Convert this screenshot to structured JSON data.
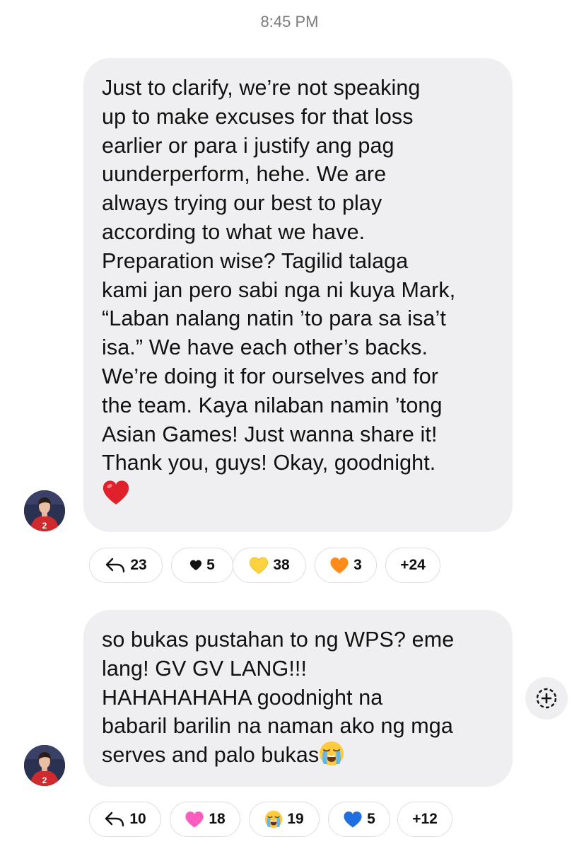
{
  "header": {
    "timestamp": "8:45 PM"
  },
  "messages": [
    {
      "text": "Just to clarify, we’re not speaking\nup to make excuses for that loss\nearlier or para i justify ang pag\nuunderperform, hehe. We are\nalways trying our best to play\naccording to what we have.\nPreparation wise? Tagilid talaga\nkami jan pero sabi nga ni kuya Mark,\n“Laban nalang natin ’to para sa isa’t\nisa.” We have each other’s backs.\nWe’re doing it for ourselves and for\nthe team. Kaya nilaban namin ’tong\nAsian Games! Just wanna share it!\nThank you, guys! Okay, goodnight.",
      "trailing_emoji": "red-heart-emoji",
      "reactions": {
        "reply_count": "23",
        "items": [
          {
            "emoji": "black-heart",
            "count": "5"
          },
          {
            "emoji": "yellow-heart",
            "count": "38"
          },
          {
            "emoji": "orange-heart",
            "count": "3"
          }
        ],
        "more": "+24"
      }
    },
    {
      "text": "so bukas pustahan to ng WPS? eme\nlang! GV GV LANG!!!\nHAHAHAHAHA goodnight na\nbabaril barilin na naman ako ng mga\nserves and palo bukas",
      "trailing_emoji": "loudly-crying-face-emoji",
      "reactions": {
        "reply_count": "10",
        "items": [
          {
            "emoji": "pink-heart",
            "count": "18"
          },
          {
            "emoji": "loudly-crying-face",
            "count": "19"
          },
          {
            "emoji": "blue-heart",
            "count": "5"
          }
        ],
        "more": "+12"
      }
    }
  ],
  "add_reaction_icon": "add-reaction-icon",
  "colors": {
    "bubble": "#efeff1",
    "timestamp": "#7c7c80",
    "red_heart": "#e0202a",
    "yellow_heart": "#ffd23f",
    "orange_heart": "#ff8c1a",
    "pink_heart": "#ff5cc0",
    "blue_heart": "#1f6fe0"
  }
}
